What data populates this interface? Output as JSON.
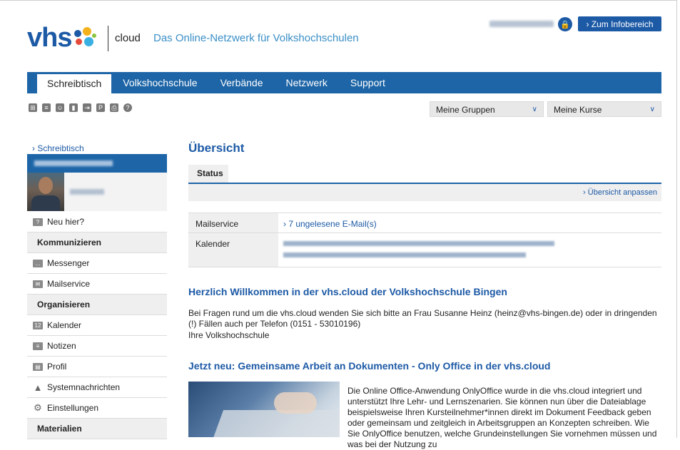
{
  "header": {
    "logo_text": "vhs",
    "cloud_label": "cloud",
    "tagline": "Das Online-Netzwerk für Volkshochschulen",
    "info_button": "› Zum Infobereich"
  },
  "nav": {
    "tabs": [
      {
        "label": "Schreibtisch",
        "active": true
      },
      {
        "label": "Volkshochschule",
        "active": false
      },
      {
        "label": "Verbände",
        "active": false
      },
      {
        "label": "Netzwerk",
        "active": false
      },
      {
        "label": "Support",
        "active": false
      }
    ]
  },
  "toolbar": {
    "icons": [
      "tree-icon",
      "note-icon",
      "users-icon",
      "bookmark-icon",
      "share-icon",
      "p-icon",
      "print-icon",
      "help-icon"
    ],
    "groups_select": "Meine Gruppen",
    "courses_select": "Meine Kurse"
  },
  "sidebar": {
    "breadcrumb": "› Schreibtisch",
    "items": [
      {
        "type": "item",
        "label": "Neu hier?",
        "icon": "user-help-icon"
      },
      {
        "type": "heading",
        "label": "Kommunizieren"
      },
      {
        "type": "item",
        "label": "Messenger",
        "icon": "messenger-icon"
      },
      {
        "type": "item",
        "label": "Mailservice",
        "icon": "mail-icon"
      },
      {
        "type": "heading",
        "label": "Organisieren"
      },
      {
        "type": "item",
        "label": "Kalender",
        "icon": "calendar-icon"
      },
      {
        "type": "item",
        "label": "Notizen",
        "icon": "notes-icon"
      },
      {
        "type": "item",
        "label": "Profil",
        "icon": "profile-icon"
      },
      {
        "type": "item",
        "label": "Systemnachrichten",
        "icon": "warning-icon"
      },
      {
        "type": "item",
        "label": "Einstellungen",
        "icon": "gear-icon"
      },
      {
        "type": "heading",
        "label": "Materialien"
      }
    ]
  },
  "main": {
    "title": "Übersicht",
    "status_tab": "Status",
    "customize_link": "› Übersicht anpassen",
    "rows": {
      "mail_label": "Mailservice",
      "mail_value": "› 7 ungelesene E-Mail(s)",
      "calendar_label": "Kalender"
    },
    "welcome_title": "Herzlich Willkommen in der vhs.cloud der Volkshochschule Bingen",
    "welcome_text_1": "Bei Fragen rund um die vhs.cloud wenden Sie sich bitte an Frau Susanne Heinz (heinz@vhs-bingen.de) oder in dringenden (!) Fällen auch per Telefon (0151 - 53010196)",
    "welcome_text_2": "Ihre Volkshochschule",
    "news_title": "Jetzt neu: Gemeinsame Arbeit an Dokumenten - Only Office in der vhs.cloud",
    "news_text": "Die Online Office-Anwendung OnlyOffice wurde in die vhs.cloud integriert und unterstützt Ihre Lehr- und Lernszenarien. Sie können nun über die Dateiablage beispielsweise Ihren Kursteilnehmer*innen direkt im Dokument Feedback geben oder gemeinsam und zeitgleich in Arbeitsgruppen an Konzepten schreiben. Wie Sie OnlyOffice benutzen, welche Grundeinstellungen Sie vornehmen müssen und was bei der Nutzung zu"
  },
  "colors": {
    "brand": "#1d5aa6",
    "nav": "#1d65a7",
    "accent_link": "#1d5aa6"
  }
}
